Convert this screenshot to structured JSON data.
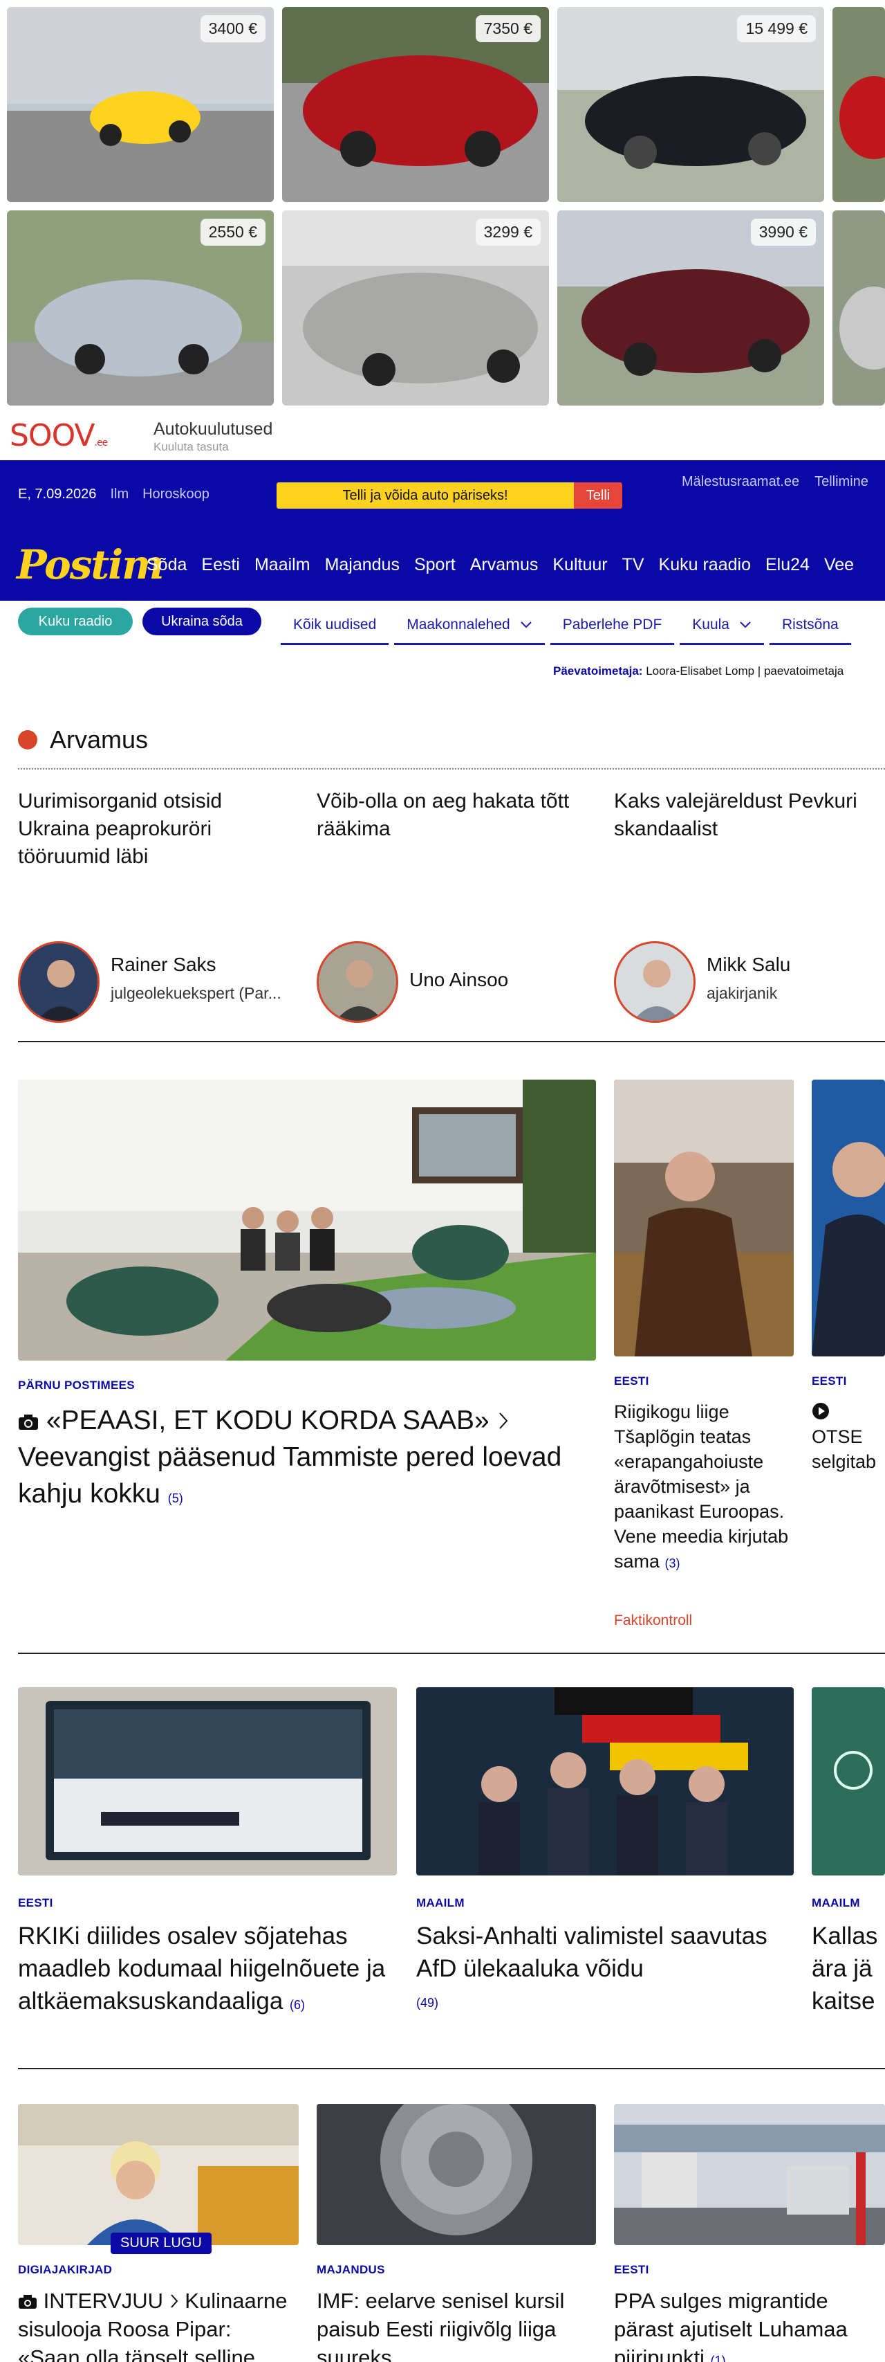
{
  "ads": {
    "cars": [
      {
        "price": "3400 €"
      },
      {
        "price": "7350 €"
      },
      {
        "price": "15 499 €"
      },
      {
        "price": "2550 €"
      },
      {
        "price": "3299 €"
      },
      {
        "price": "3990 €"
      }
    ],
    "soov_logo": "SOOV",
    "soov_logo_suffix": ".ee",
    "soov_title": "Autokuulutused",
    "soov_sub": "Kuuluta tasuta"
  },
  "topbar": {
    "date": "E, 7.09.2026",
    "weather": "Ilm",
    "horoscope": "Horoskoop",
    "promo_text": "Telli ja võida auto päriseks!",
    "promo_button": "Telli",
    "link1": "Mälestusraamat.ee",
    "link2": "Tellimine"
  },
  "nav": {
    "logo": "Postim",
    "items": [
      "Sõda",
      "Eesti",
      "Maailm",
      "Majandus",
      "Sport",
      "Arvamus",
      "Kultuur",
      "TV",
      "Kuku raadio",
      "Elu24",
      "Vee"
    ]
  },
  "subnav": {
    "pill1": "Kuku raadio",
    "pill2": "Ukraina sõda",
    "tabs": [
      "Kõik uudised",
      "Maakonnalehed",
      "Paberlehe PDF",
      "Kuula",
      "Ristsõna"
    ],
    "editor_label": "Päevatoimetaja:",
    "editor_name": "Loora-Elisabet Lomp",
    "editor_more": "paevatoimetaja"
  },
  "opinion": {
    "title": "Arvamus",
    "headlines": [
      "Uurimisorganid otsisid Ukraina peaprokuröri tööruumid läbi",
      "Võib-olla on aeg hakata tõtt rääkima",
      "Kaks valejäreldust Pevkuri skandaalist"
    ],
    "authors": [
      {
        "name": "Rainer Saks",
        "role": "julgeolekuekspert (Par..."
      },
      {
        "name": "Uno Ainsoo",
        "role": ""
      },
      {
        "name": "Mikk Salu",
        "role": "ajakirjanik"
      }
    ]
  },
  "main": {
    "lead_cat": "PÄRNU POSTIMEES",
    "lead_kicker": "«PEAASI, ET KODU KORDA SAAB»",
    "lead_title": "Veevangist pääsenud Tammiste pered loevad kahju kokku",
    "lead_count": "(5)",
    "side1_cat": "EESTI",
    "side1_title": "Riigikogu liige Tšaplõgin teatas «erapangahoiuste äravõtmisest» ja paanikast Euroopas. Vene meedia kirjutab sama",
    "side1_count": "(3)",
    "side1_tag": "Faktikontroll",
    "side2_cat": "EESTI",
    "side2_title": "OTSE selgitab kaitsev hankeid"
  },
  "row2": [
    {
      "cat": "EESTI",
      "title": "RKIKi diilides osalev sõjatehas maadleb kodumaal hiigelnõuete ja altkäemaksuskandaaliga",
      "count": "(6)"
    },
    {
      "cat": "MAAILM",
      "title": "Saksi-Anhalti valimistel saavutas AfD ülekaaluka võidu",
      "count": "(49)"
    },
    {
      "cat": "MAAILM",
      "title": "Kallas ära jä kaitse"
    }
  ],
  "row3": [
    {
      "cat": "DIGIAJAKIRJAD",
      "badge": "SUUR LUGU",
      "kicker": "INTERVJUU",
      "title": "Kulinaarne sisulooja Roosa Pipar: «Saan olla täpselt selline"
    },
    {
      "cat": "MAJANDUS",
      "title": "IMF: eelarve senisel kursil paisub Eesti riigivõlg liiga suureks"
    },
    {
      "cat": "EESTI",
      "title": "PPA sulges migrantide pärast ajutiselt Luhamaa piiripunkti",
      "count": "(1)"
    }
  ]
}
